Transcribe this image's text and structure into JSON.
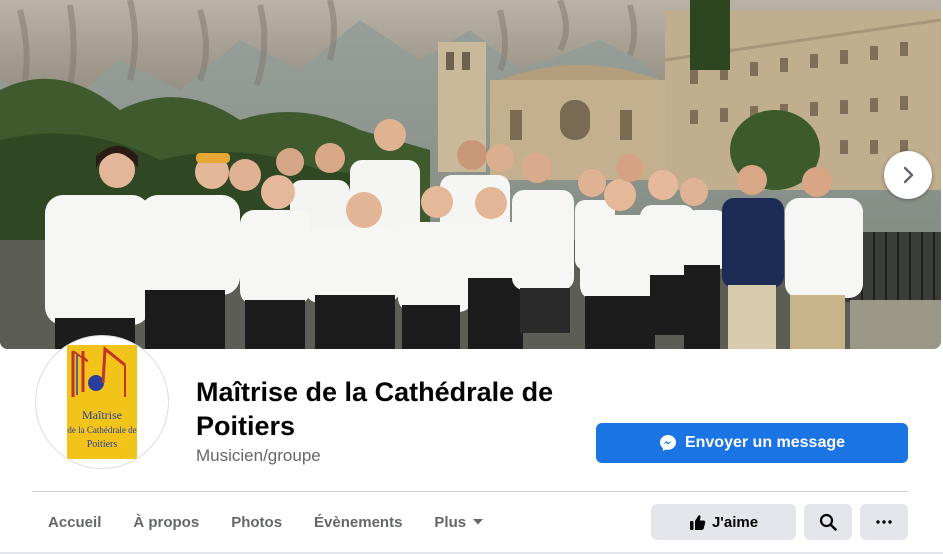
{
  "page": {
    "name": "Maîtrise de la Cathédrale de Poitiers",
    "category": "Musicien/groupe"
  },
  "cover": {
    "next_icon": "chevron-right-icon"
  },
  "avatar": {
    "logo_text": [
      "Maîtrise",
      "de la Cathédrale de",
      "Poitiers"
    ]
  },
  "actions": {
    "message_label": "Envoyer un message",
    "message_icon": "messenger-icon",
    "like_label": "J'aime",
    "like_icon": "thumbs-up-icon",
    "search_icon": "search-icon",
    "more_icon": "more-horizontal-icon"
  },
  "tabs": [
    {
      "label": "Accueil"
    },
    {
      "label": "À propos"
    },
    {
      "label": "Photos"
    },
    {
      "label": "Évènements"
    },
    {
      "label": "Plus"
    }
  ],
  "colors": {
    "primary": "#1b74e4",
    "secondary_button": "#e4e6eb",
    "secondary_text": "#65676b",
    "logo_yellow": "#f2c318"
  }
}
